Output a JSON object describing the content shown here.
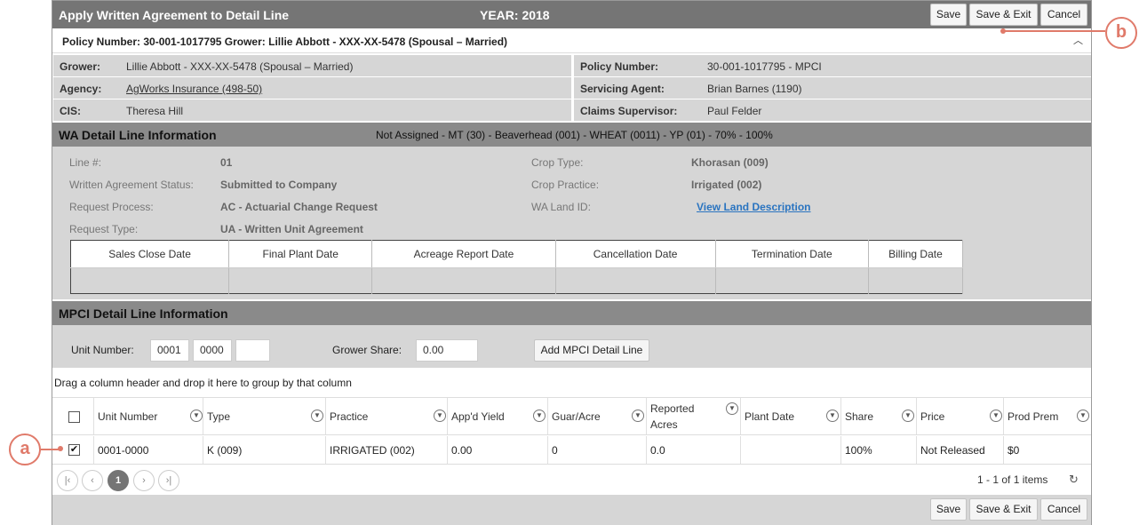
{
  "titlebar": {
    "title": "Apply Written Agreement to Detail Line",
    "year": "YEAR: 2018"
  },
  "buttons": {
    "save": "Save",
    "save_exit": "Save & Exit",
    "cancel": "Cancel"
  },
  "policy_bar": {
    "text": "Policy Number: 30-001-1017795 Grower: Lillie Abbott - XXX-XX-5478 (Spousal – Married)",
    "collapse_glyph": "︿"
  },
  "info": {
    "grower_label": "Grower:",
    "grower_value": "Lillie Abbott - XXX-XX-5478 (Spousal – Married)",
    "policy_label": "Policy Number:",
    "policy_value": "30-001-1017795 - MPCI",
    "agency_label": "Agency:",
    "agency_value": "AgWorks Insurance (498-50)",
    "servicing_label": "Servicing Agent:",
    "servicing_value": "Brian Barnes (1190)",
    "cis_label": "CIS:",
    "cis_value": "Theresa Hill",
    "claims_label": "Claims Supervisor:",
    "claims_value": "Paul Felder"
  },
  "wa_section": {
    "title": "WA Detail Line Information",
    "summary": "Not Assigned - MT (30) - Beaverhead (001) - WHEAT (0011) - YP (01) - 70% - 100%",
    "line_label": "Line #:",
    "line_value": "01",
    "status_label": "Written Agreement Status:",
    "status_value": "Submitted to Company",
    "process_label": "Request Process:",
    "process_value": "AC - Actuarial Change Request",
    "type_label": "Request Type:",
    "type_value": "UA - Written Unit Agreement",
    "crop_type_label": "Crop Type:",
    "crop_type_value": "Khorasan (009)",
    "crop_practice_label": "Crop Practice:",
    "crop_practice_value": "Irrigated (002)",
    "land_id_label": "WA Land ID:",
    "land_id_link": "View Land Description",
    "date_columns": [
      "Sales Close Date",
      "Final Plant Date",
      "Acreage Report Date",
      "Cancellation Date",
      "Termination Date",
      "Billing Date"
    ]
  },
  "mpci_section": {
    "title": "MPCI Detail Line Information",
    "unit_label": "Unit Number:",
    "unit_part1": "0001",
    "unit_part2": "0000",
    "unit_part3": "",
    "share_label": "Grower Share:",
    "share_value": "0.00",
    "add_button": "Add MPCI Detail Line"
  },
  "grid": {
    "group_hint": "Drag a column header and drop it here to group by that column",
    "headers": [
      "Unit Number",
      "Type",
      "Practice",
      "App'd Yield",
      "Guar/Acre",
      "Reported Acres",
      "Plant Date",
      "Share",
      "Price",
      "Prod Prem"
    ],
    "rows": [
      {
        "checked": true,
        "cells": [
          "0001-0000",
          "K (009)",
          "IRRIGATED (002)",
          "0.00",
          "0",
          "0.0",
          "",
          "100%",
          "Not Released",
          "$0"
        ]
      }
    ],
    "reported_line1": "Reported",
    "reported_line2": "Acres",
    "check_glyph": "✔"
  },
  "pager": {
    "first": "|‹",
    "prev": "‹",
    "current": "1",
    "next": "›",
    "last": "›|",
    "info": "1 - 1 of 1 items",
    "refresh": "↻"
  },
  "callouts": {
    "a": "a",
    "b": "b"
  },
  "colors": {
    "titlebar": "#757575",
    "section": "#8a8a8a",
    "panel": "#d6d6d6",
    "link": "#2a74c0",
    "callout": "#e07a6a"
  },
  "icons": {
    "filter": "filter-icon",
    "refresh": "refresh-icon",
    "collapse": "chevron-up-icon"
  }
}
